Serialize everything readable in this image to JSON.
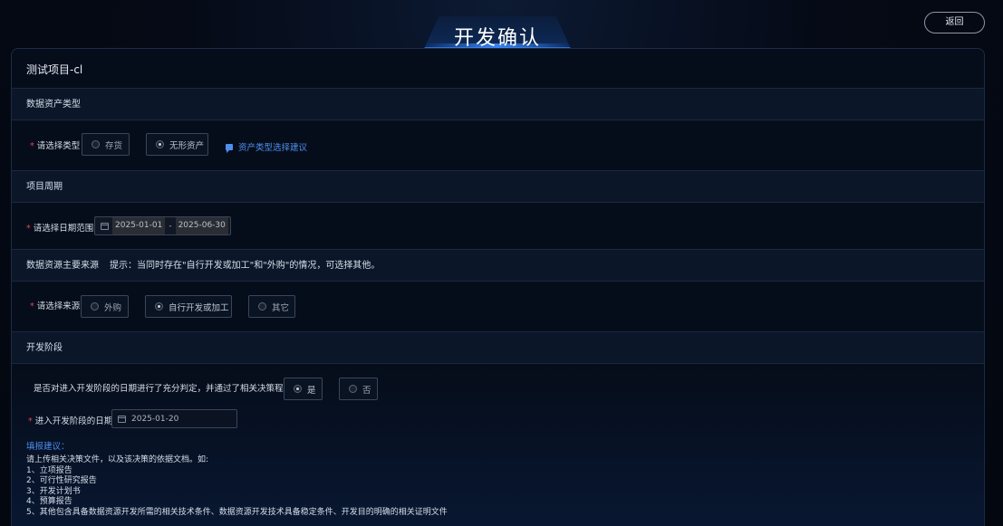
{
  "header": {
    "title": "开发确认",
    "back_label": "返回"
  },
  "project": {
    "name": "测试项目-cl"
  },
  "asset_type": {
    "section_title": "数据资产类型",
    "label": "请选择类型",
    "options": [
      {
        "label": "存货",
        "selected": false
      },
      {
        "label": "无形资产",
        "selected": true
      }
    ],
    "suggest_link": "资产类型选择建议"
  },
  "period": {
    "section_title": "项目周期",
    "label": "请选择日期范围",
    "start": "2025-01-01",
    "separator": "-",
    "end": "2025-06-30"
  },
  "source": {
    "section_title": "数据资源主要来源",
    "tip": "提示：当同时存在\"自行开发或加工\"和\"外购\"的情况，可选择其他。",
    "label": "请选择来源",
    "options": [
      {
        "label": "外购",
        "selected": false
      },
      {
        "label": "自行开发或加工",
        "selected": true
      },
      {
        "label": "其它",
        "selected": false
      }
    ]
  },
  "dev_stage": {
    "section_title": "开发阶段",
    "question": "是否对进入开发阶段的日期进行了充分判定，并通过了相关决策程序?",
    "options": [
      {
        "label": "是",
        "selected": true
      },
      {
        "label": "否",
        "selected": false
      }
    ],
    "date_label": "进入开发阶段的日期",
    "date_value": "2025-01-20",
    "hint_title": "填报建议：",
    "hint_lines": [
      "请上传相关决策文件，以及该决策的依据文档。如:",
      "1、立项报告",
      "2、可行性研究报告",
      "3、开发计划书",
      "4、预算报告",
      "5、其他包含具备数据资源开发所需的相关技术条件、数据资源开发技术具备稳定条件、开发目的明确的相关证明文件"
    ]
  },
  "colors": {
    "accent": "#4d8ff0",
    "required": "#e04848",
    "background": "#03070f"
  }
}
